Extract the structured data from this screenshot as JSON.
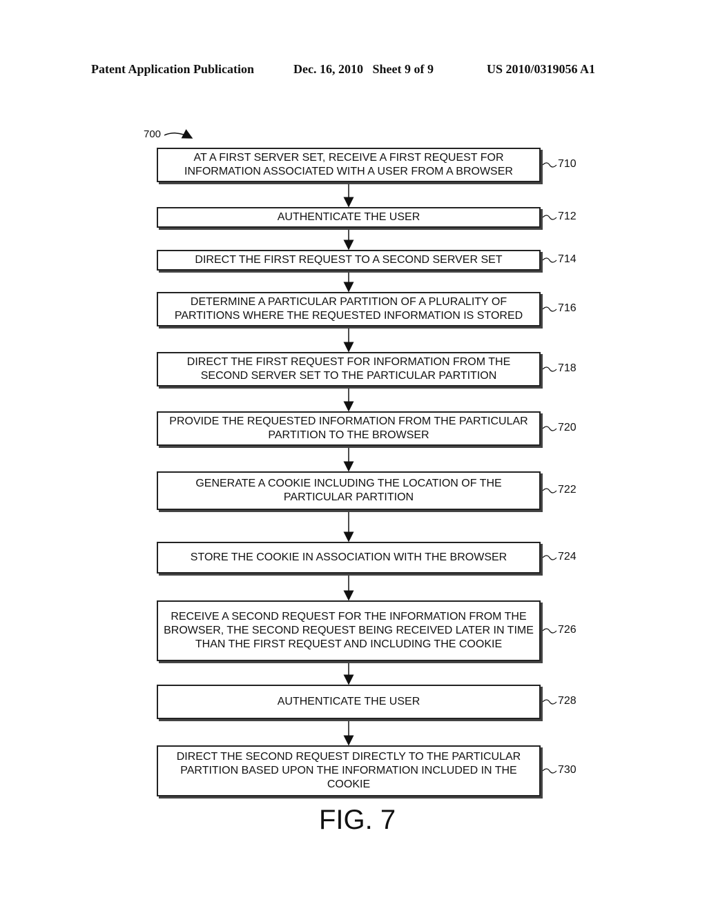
{
  "header": {
    "publication": "Patent Application Publication",
    "date_sheet": "Dec. 16, 2010   Sheet 9 of 9",
    "number": "US 2010/0319056 A1"
  },
  "diagram": {
    "label": "700",
    "figure": "FIG. 7",
    "steps": [
      {
        "ref": "710",
        "text": "AT A FIRST SERVER SET, RECEIVE A FIRST REQUEST FOR INFORMATION ASSOCIATED WITH A USER FROM A BROWSER"
      },
      {
        "ref": "712",
        "text": "AUTHENTICATE THE USER"
      },
      {
        "ref": "714",
        "text": "DIRECT THE FIRST REQUEST TO A SECOND SERVER SET"
      },
      {
        "ref": "716",
        "text": "DETERMINE A PARTICULAR PARTITION OF A PLURALITY OF PARTITIONS WHERE THE REQUESTED INFORMATION IS STORED"
      },
      {
        "ref": "718",
        "text": "DIRECT THE FIRST REQUEST FOR INFORMATION FROM THE SECOND SERVER SET TO THE PARTICULAR PARTITION"
      },
      {
        "ref": "720",
        "text": "PROVIDE THE REQUESTED INFORMATION FROM THE PARTICULAR PARTITION TO THE BROWSER"
      },
      {
        "ref": "722",
        "text": "GENERATE A COOKIE INCLUDING THE LOCATION OF THE PARTICULAR PARTITION"
      },
      {
        "ref": "724",
        "text": "STORE THE COOKIE IN ASSOCIATION WITH THE BROWSER"
      },
      {
        "ref": "726",
        "text": "RECEIVE A SECOND REQUEST FOR THE INFORMATION FROM THE BROWSER, THE SECOND REQUEST BEING RECEIVED LATER IN TIME THAN THE FIRST REQUEST AND INCLUDING THE COOKIE"
      },
      {
        "ref": "728",
        "text": "AUTHENTICATE THE USER"
      },
      {
        "ref": "730",
        "text": "DIRECT THE SECOND REQUEST DIRECTLY TO THE PARTICULAR PARTITION BASED UPON THE INFORMATION INCLUDED IN THE COOKIE"
      }
    ]
  }
}
